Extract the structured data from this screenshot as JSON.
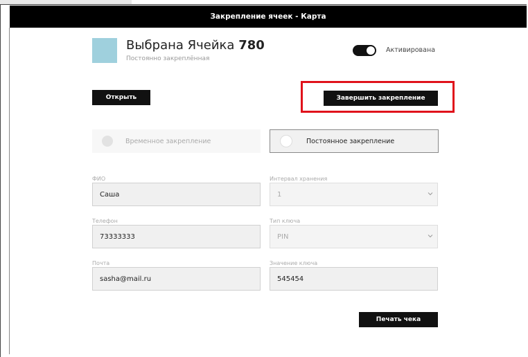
{
  "header": {
    "title": "Закрепление ячеек - Карта"
  },
  "cell": {
    "title_prefix": "Выбрана Ячейка",
    "number": "780",
    "subtitle": "Постоянно закреплённая",
    "swatch_color": "#9fd0dd"
  },
  "toggle": {
    "label": "Активирована",
    "on": true
  },
  "buttons": {
    "open": "Открыть",
    "finish": "Завершить закрепление",
    "print": "Печать чека"
  },
  "options": {
    "temporary": "Временное закрепление",
    "permanent": "Постоянное закрепление",
    "selected": "permanent"
  },
  "form": {
    "name": {
      "label": "ФИО",
      "value": "Саша"
    },
    "phone": {
      "label": "Телефон",
      "value": "73333333"
    },
    "email": {
      "label": "Почта",
      "value": "sasha@mail.ru"
    },
    "interval": {
      "label": "Интервал хранения",
      "value": "1"
    },
    "key_type": {
      "label": "Тип ключа",
      "value": "PIN"
    },
    "key_value": {
      "label": "Значение ключа",
      "value": "545454"
    }
  },
  "colors": {
    "highlight": "#e0121b",
    "accent_dark": "#111111"
  }
}
